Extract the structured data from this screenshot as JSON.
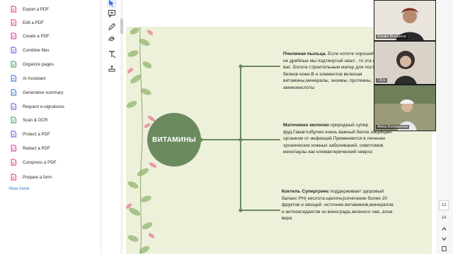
{
  "sidebar": {
    "items": [
      {
        "label": "Export a PDF",
        "icon": "export-pdf-icon",
        "color": "#d6338a"
      },
      {
        "label": "Edit a PDF",
        "icon": "edit-pdf-icon",
        "color": "#d6338a"
      },
      {
        "label": "Create a PDF",
        "icon": "create-pdf-icon",
        "color": "#d6338a"
      },
      {
        "label": "Combine files",
        "icon": "combine-files-icon",
        "color": "#7a4bd6"
      },
      {
        "label": "Organize pages",
        "icon": "organize-pages-icon",
        "color": "#2f9e44"
      },
      {
        "label": "AI Assistant",
        "icon": "ai-assistant-icon",
        "color": "#2f6fd6"
      },
      {
        "label": "Generative summary",
        "icon": "generative-summary-icon",
        "color": "#2f6fd6"
      },
      {
        "label": "Request e-signatures",
        "icon": "request-esignatures-icon",
        "color": "#7a4bd6"
      },
      {
        "label": "Scan & OCR",
        "icon": "scan-ocr-icon",
        "color": "#2f9e44"
      },
      {
        "label": "Protect a PDF",
        "icon": "protect-pdf-icon",
        "color": "#7a4bd6"
      },
      {
        "label": "Redact a PDF",
        "icon": "redact-pdf-icon",
        "color": "#d6338a"
      },
      {
        "label": "Compress a PDF",
        "icon": "compress-pdf-icon",
        "color": "#d6338a"
      },
      {
        "label": "Prepare a form",
        "icon": "prepare-form-icon",
        "color": "#d6338a"
      }
    ],
    "view_more": "View more"
  },
  "toolstrip": {
    "icons": [
      "select-cursor-icon",
      "add-comment-icon",
      "highlight-pen-icon",
      "draw-loop-icon",
      "text-edit-icon",
      "stamp-icon"
    ]
  },
  "document": {
    "center_label": "ВИТАМИНЫ",
    "branches": [
      {
        "title": "Пчелиная пыльца.",
        "body": " Если хотите хороший тургор, не дряблые мы подтянутый овал , то эта супер е вас. Богата строительным матер для построения белков кожи.В н элементов включая витамины,минералы, энзимы, протеины, аминокислоты"
      },
      {
        "title": "Маточкино молочко",
        "body": " природный супер фуд.Гамаглобулин очень важный белок защищает организм от инфекций.Применяется в лечении хронических кожных заболеваний, симптомов менопаузы как климактерический невроз"
      },
      {
        "title": "Коктель Супергринс",
        "body": "  поддерживает здоровый баланс РН( кислота-щелочь)сочетание более 20 фруктов и овощей -источник витаминов,минералов и антиоксидантов из винограда,зеленого чая, алое вера"
      }
    ],
    "colors": {
      "page_bg": "#eef1da",
      "node": "#6b8a5e",
      "line": "#6b8a5e",
      "leaf_green": "#a9c48a",
      "leaf_pink": "#e79aa6"
    }
  },
  "video": {
    "participants": [
      {
        "name": "Natalia Bozdueva"
      },
      {
        "name": "Liliya"
      },
      {
        "name": "Alena Komjanevez"
      }
    ]
  },
  "page_rail": {
    "pages": [
      "12",
      "14"
    ]
  }
}
